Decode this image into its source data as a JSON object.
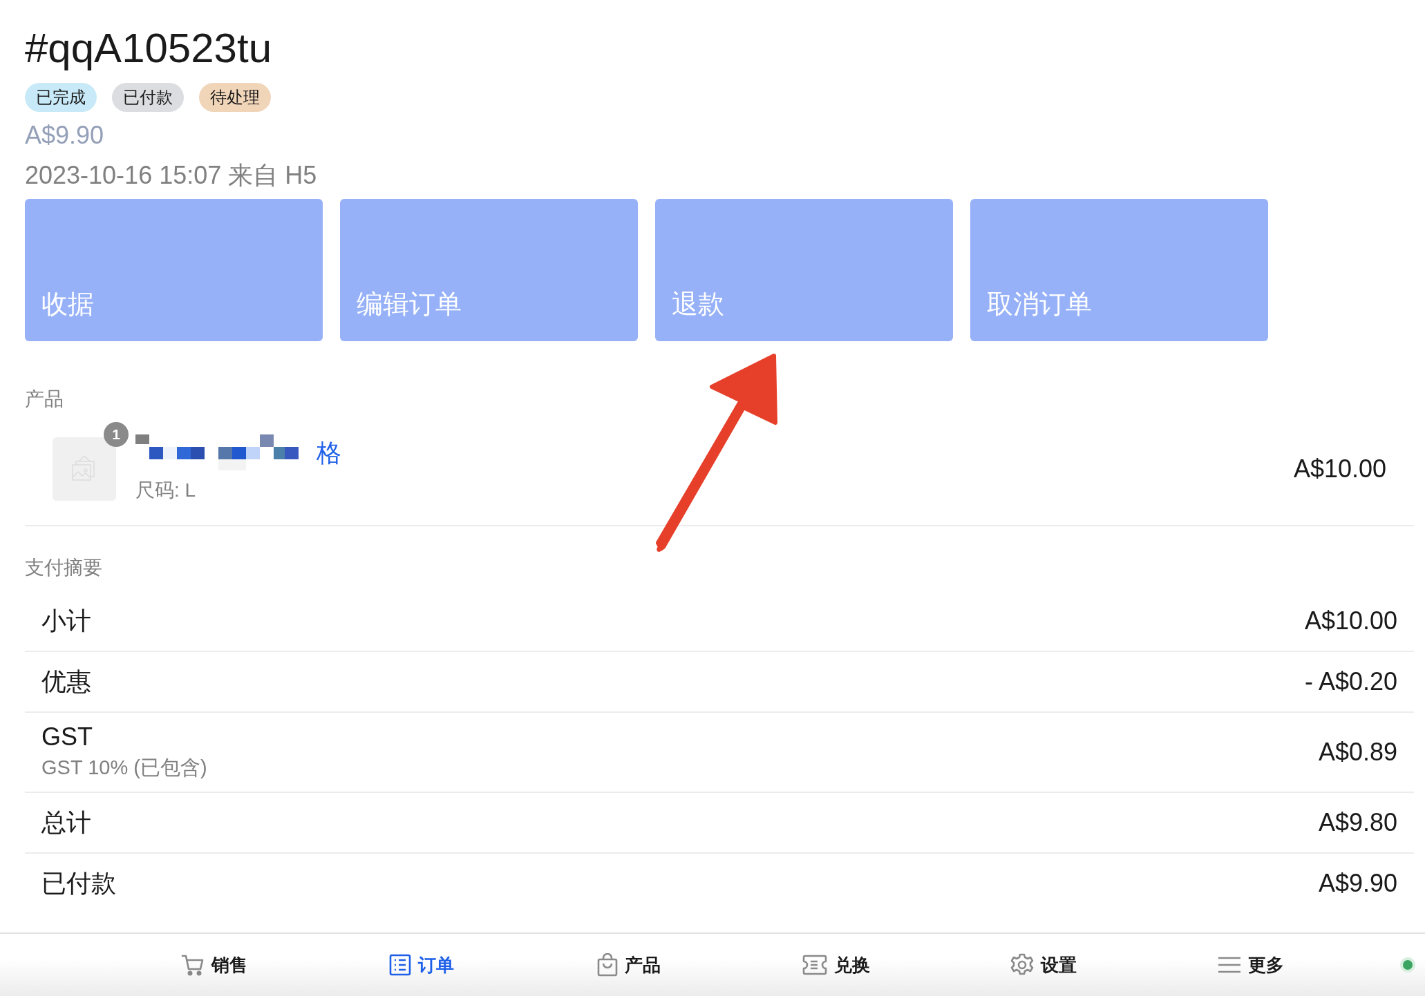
{
  "order": {
    "number": "#qqA10523tu",
    "price": "A$9.90",
    "meta": "2023-10-16 15:07 来自 H5"
  },
  "tags": [
    {
      "label": "已完成",
      "color": "#c8eaf8"
    },
    {
      "label": "已付款",
      "color": "#dcdde0"
    },
    {
      "label": "待处理",
      "color": "#f1d5b9"
    }
  ],
  "actions": [
    "收据",
    "编辑订单",
    "退款",
    "取消订单"
  ],
  "products": {
    "heading": "产品",
    "items": [
      {
        "quantity": "1",
        "name_tail": "格",
        "option": "尺码: L",
        "price": "A$10.00"
      }
    ]
  },
  "summary": {
    "heading": "支付摘要",
    "rows": [
      {
        "label": "小计",
        "value": "A$10.00"
      },
      {
        "label": "优惠",
        "value": "- A$0.20"
      },
      {
        "label": "GST",
        "note": "GST 10% (已包含)",
        "value": "A$0.89"
      },
      {
        "label": "总计",
        "value": "A$9.80"
      },
      {
        "label": "已付款",
        "value": "A$9.90"
      }
    ]
  },
  "nav": [
    {
      "label": "销售",
      "selected": false
    },
    {
      "label": "订单",
      "selected": true
    },
    {
      "label": "产品",
      "selected": false
    },
    {
      "label": "兑换",
      "selected": false
    },
    {
      "label": "设置",
      "selected": false
    },
    {
      "label": "更多",
      "selected": false
    }
  ],
  "status": {
    "color": "#3aa560"
  }
}
